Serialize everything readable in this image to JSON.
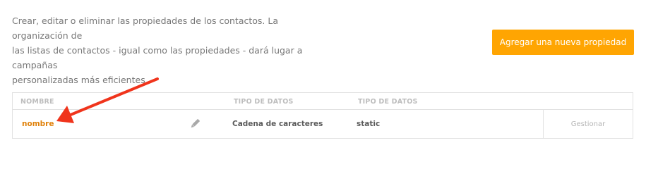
{
  "description": {
    "line1": "Crear, editar o eliminar las propiedades de los contactos. La organización de",
    "line2": "las listas de contactos - igual como las propiedades - dará lugar a campañas",
    "line3": "personalizadas más eficientes."
  },
  "add_button_label": "Agregar una nueva propiedad",
  "table": {
    "headers": [
      "NOMBRE",
      "TIPO DE DATOS",
      "TIPO DE DATOS"
    ],
    "rows": [
      {
        "name": "nombre",
        "data_type": "Cadena de caracteres",
        "kind": "static",
        "action": "Gestionar"
      }
    ]
  },
  "icons": {
    "edit": "pencil-icon",
    "annotation": "red-arrow-annotation"
  },
  "colors": {
    "accent": "#ffa502",
    "link": "#e0820c",
    "annotation": "#f0341c"
  }
}
